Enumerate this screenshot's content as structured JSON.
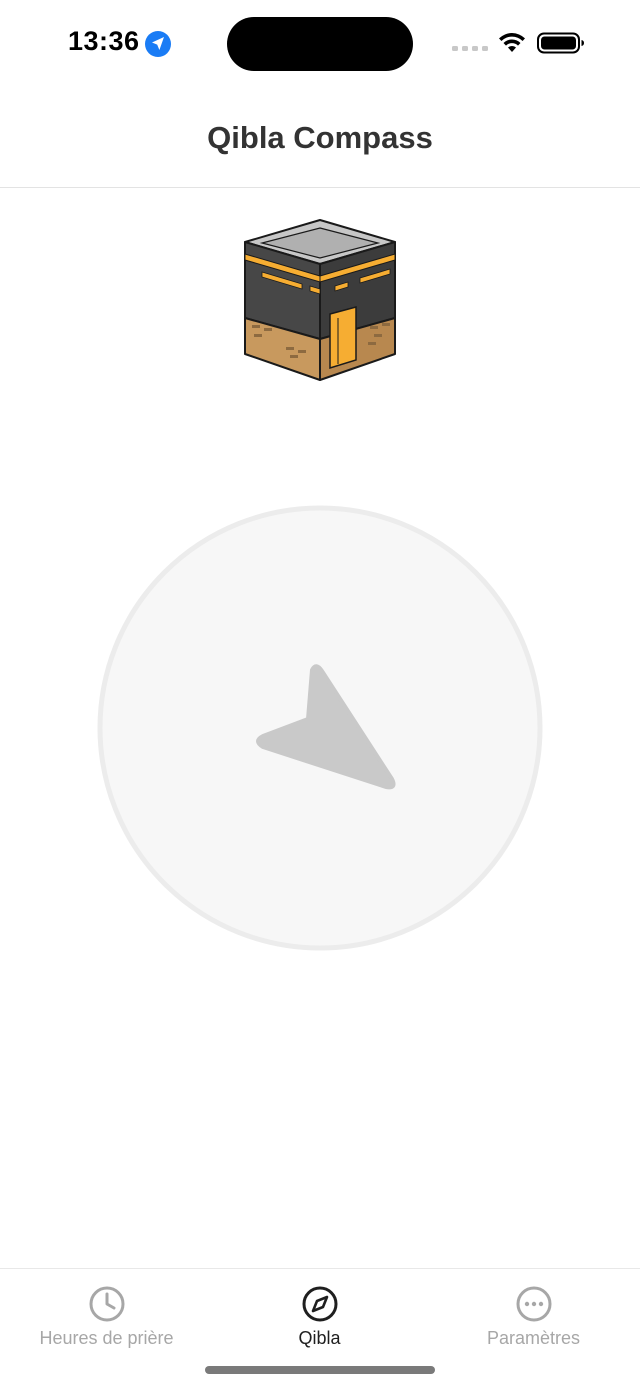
{
  "status_bar": {
    "time": "13:36"
  },
  "nav": {
    "title": "Qibla Compass"
  },
  "compass": {
    "needle_bearing_deg": 148
  },
  "tab_bar": {
    "tabs": [
      {
        "label": "Heures de prière",
        "icon": "clock-icon",
        "active": false
      },
      {
        "label": "Qibla",
        "icon": "compass-icon",
        "active": true
      },
      {
        "label": "Paramètres",
        "icon": "more-icon",
        "active": false
      }
    ]
  },
  "colors": {
    "title": "#333333",
    "tab_inactive": "#a7a7a7",
    "tab_active": "#1f1f1f",
    "compass_fill": "#f7f7f7",
    "compass_ring": "#ececec",
    "needle": "#c9c9c9",
    "location_blue": "#1a7cf5"
  }
}
